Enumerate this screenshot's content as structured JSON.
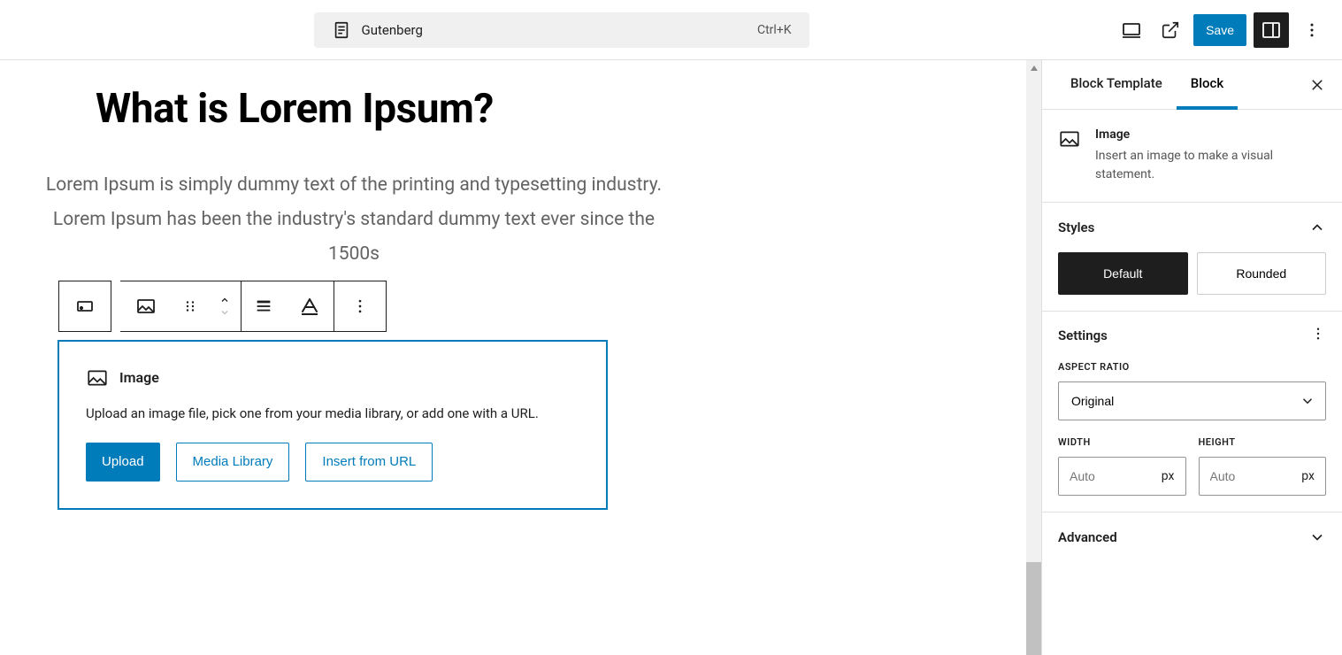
{
  "topbar": {
    "doc_name": "Gutenberg",
    "shortcut": "Ctrl+K",
    "save_label": "Save"
  },
  "content": {
    "title": "What is Lorem Ipsum?",
    "paragraph": "Lorem Ipsum is simply dummy text of the printing and typesetting industry. Lorem Ipsum has been the industry's standard dummy text ever since the 1500s"
  },
  "image_block": {
    "title": "Image",
    "description": "Upload an image file, pick one from your media library, or add one with a URL.",
    "upload_label": "Upload",
    "media_library_label": "Media Library",
    "url_label": "Insert from URL"
  },
  "sidebar": {
    "tabs": {
      "template": "Block Template",
      "block": "Block"
    },
    "block_info": {
      "name": "Image",
      "desc": "Insert an image to make a visual statement."
    },
    "styles": {
      "heading": "Styles",
      "default": "Default",
      "rounded": "Rounded"
    },
    "settings": {
      "heading": "Settings",
      "aspect_ratio_label": "ASPECT RATIO",
      "aspect_ratio_value": "Original",
      "width_label": "WIDTH",
      "height_label": "HEIGHT",
      "auto_placeholder": "Auto",
      "unit": "px"
    },
    "advanced": {
      "heading": "Advanced"
    }
  }
}
